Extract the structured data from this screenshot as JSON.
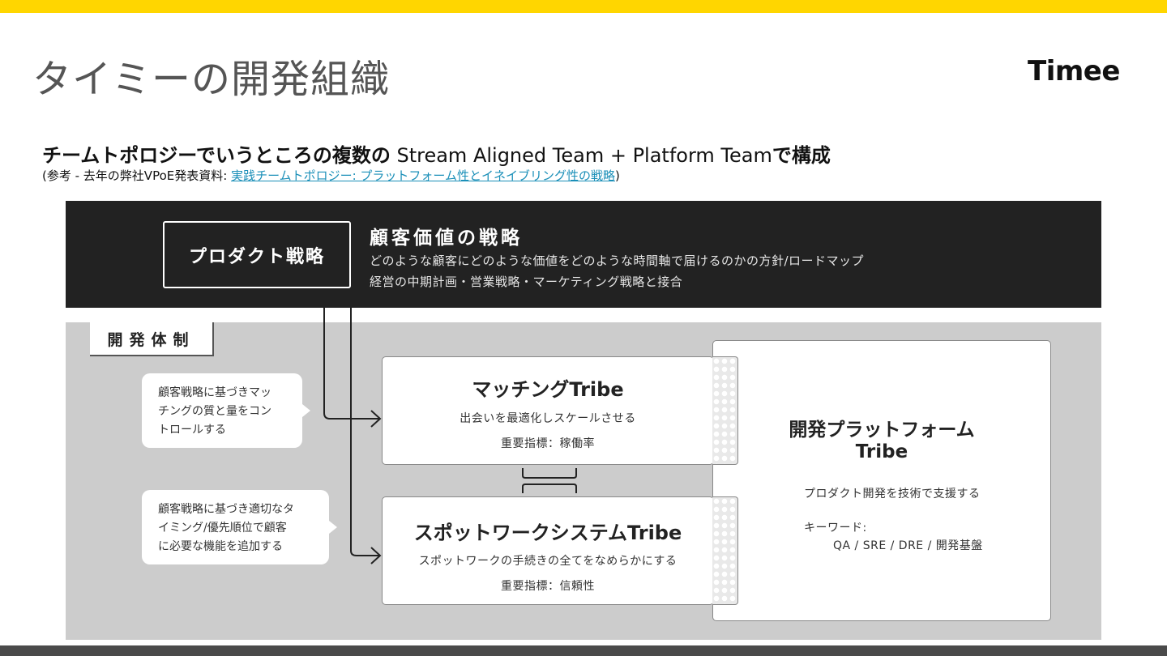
{
  "slide": {
    "title": "タイミーの開発組織",
    "brand": "Timee",
    "subtitle_jp": "チームトポロジーでいうところの複数の",
    "subtitle_en": " Stream Aligned Team + Platform Team",
    "subtitle_tail": "で構成",
    "ref_prefix": "(参考 - 去年の弊社VPoE発表資料: ",
    "ref_link": "実践チームトポロジー: プラットフォーム性とイネイブリング性の戦略",
    "ref_suffix": ")"
  },
  "strategy": {
    "box_label": "プロダクト戦略",
    "heading": "顧客価値の戦略",
    "desc_line1": "どのような顧客にどのような価値をどのような時間軸で届けるのかの方針/ロードマップ",
    "desc_line2": "経営の中期計画・営業戦略・マーケティング戦略と接合"
  },
  "org": {
    "label": "開発体制",
    "bubble1": [
      "顧客戦略に基づきマッ",
      "チングの質と量をコン",
      "トロールする"
    ],
    "bubble2": [
      "顧客戦略に基づき適切なタ",
      "イミング/優先順位で顧客",
      "に必要な機能を追加する"
    ],
    "matching": {
      "title": "マッチングTribe",
      "desc": "出会いを最適化しスケールさせる",
      "kpi": "重要指標：稼働率"
    },
    "spot": {
      "title": "スポットワークシステムTribe",
      "desc": "スポットワークの手続きの全てをなめらかにする",
      "kpi": "重要指標：信頼性"
    },
    "platform": {
      "title_line1": "開発プラットフォーム",
      "title_line2": "Tribe",
      "desc": "プロダクト開発を技術で支援する",
      "keywords_label": "キーワード:",
      "keywords": "QA / SRE / DRE / 開発基盤"
    }
  },
  "colors": {
    "accent": "#ffd600",
    "band": "#222222",
    "panel": "#cccccc",
    "link": "#1a8fb8"
  }
}
